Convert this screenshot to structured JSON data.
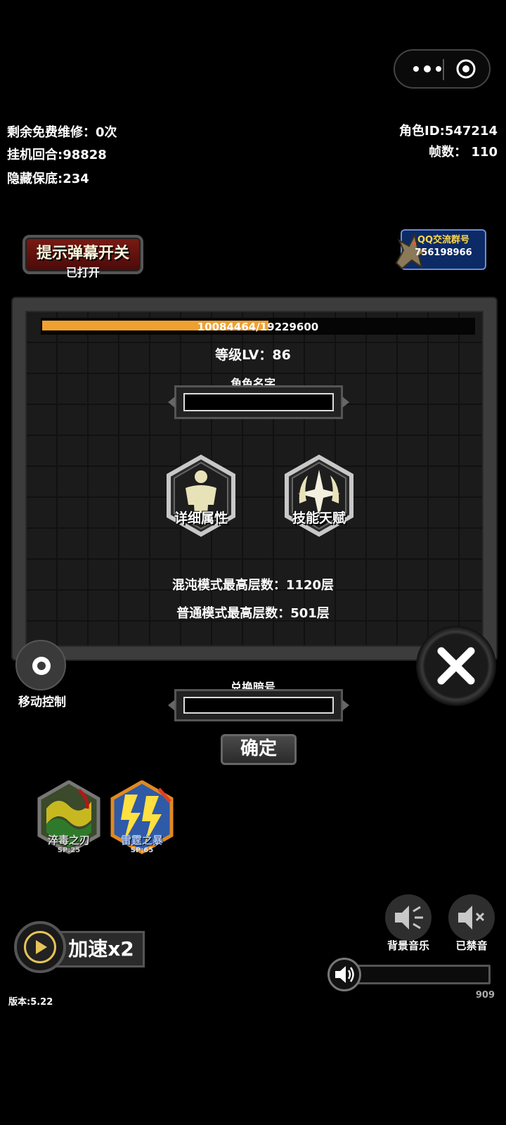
{
  "status": {
    "free_repair": "剩余免费维修：0次",
    "idle_rounds": "挂机回合:98828",
    "hidden_pity": "隐藏保底:234",
    "role_id": "角色ID:547214",
    "fps": "帧数： 110"
  },
  "barrage_toggle": {
    "title": "提示弹幕开关",
    "state": "已打开"
  },
  "qq_group": {
    "title": "QQ交流群号",
    "number": "756198966"
  },
  "character": {
    "xp_text": "10084464/19229600",
    "xp_progress": 0.524,
    "level": "等级LV：86",
    "name_label": "角色名字",
    "name_value": "",
    "detail_button": "详细属性",
    "talent_button": "技能天赋",
    "chaos_floor": "混沌模式最高层数：1120层",
    "normal_floor": "普通模式最高层数：501层"
  },
  "controls": {
    "move_label": "移动控制",
    "code_label": "兑换暗号",
    "code_value": "",
    "confirm": "确定"
  },
  "skills": [
    {
      "name": "淬毒之刃",
      "sp": "SP:25",
      "icon": "poison-blade-icon"
    },
    {
      "name": "雷霆之暴",
      "sp": "SP:65",
      "icon": "thunder-storm-icon"
    }
  ],
  "speed_button": "加速x2",
  "sound": {
    "bgm": "背景音乐",
    "mute": "已禁音",
    "volume_value": "909"
  },
  "version": "版本:5.22",
  "colors": {
    "xp_bar": "#f0a030",
    "skill_blue_text": "#a8c8ff",
    "gold": "#e7c35a"
  }
}
